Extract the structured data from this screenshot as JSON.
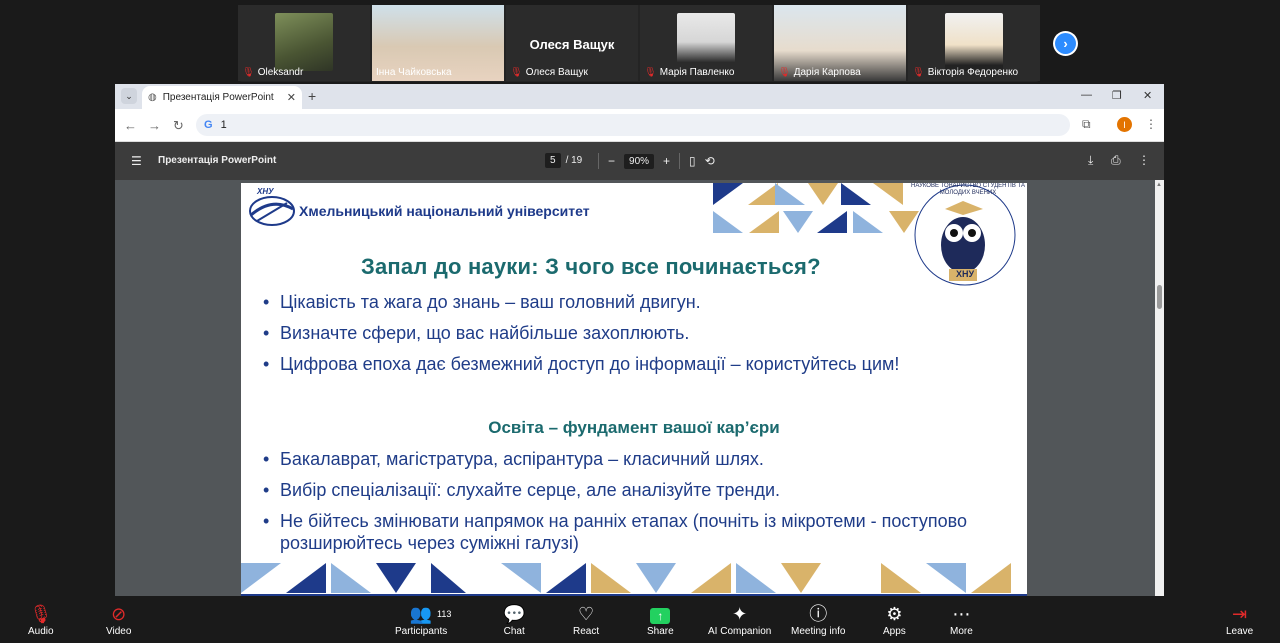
{
  "participants": [
    {
      "name": "Oleksandr",
      "muted": true
    },
    {
      "name": "Інна Чайковська",
      "muted": false,
      "active": true
    },
    {
      "name": "Олеся Ващук",
      "muted": true,
      "display_name": "Олеся Ващук"
    },
    {
      "name": "Марія Павленко",
      "muted": true
    },
    {
      "name": "Дарія Карпова",
      "muted": true
    },
    {
      "name": "Вікторія Федоренко",
      "muted": true
    }
  ],
  "browser": {
    "tab_title": "Презентація PowerPoint",
    "address": "1",
    "profile_initial": "I"
  },
  "pdf": {
    "title": "Презентація PowerPoint",
    "current_page": "5",
    "total_pages": "/ 19",
    "zoom": "90%"
  },
  "slide": {
    "university": "Хмельницький національний університет",
    "logo_text": "ХНУ",
    "heading": "Запал до науки: З чого все починається?",
    "bullets_top": [
      "Цікавість та жага до знань – ваш головний двигун.",
      "Визначте сфери, що вас найбільше захоплюють.",
      "Цифрова епоха дає безмежний доступ до інформації – користуйтесь цим!"
    ],
    "subheading": "Освіта – фундамент вашої кар’єри",
    "bullets_bottom": [
      "Бакалаврат, магістратура, аспірантура – класичний шлях.",
      "Вибір спеціалізації: слухайте серце, але аналізуйте тренди.",
      "Не бійтесь змінювати напрямок на ранніх етапах (почніть із мікротеми - поступово розширюйтесь через суміжні галузі)"
    ],
    "badge_text": "НАУКОВЕ ТОВАРИСТВО СТУДЕНТІВ ТА МОЛОДИХ ВЧЕНИХ",
    "badge_label": "ХНУ"
  },
  "toolbar": {
    "audio": "Audio",
    "video": "Video",
    "participants": "Participants",
    "participants_count": "113",
    "chat": "Chat",
    "react": "React",
    "share": "Share",
    "ai_companion": "AI Companion",
    "meeting_info": "Meeting info",
    "apps": "Apps",
    "more": "More",
    "leave": "Leave"
  },
  "colors": {
    "share_green": "#23d160",
    "mute_red": "#e02a2a",
    "slide_teal": "#1b6a6e",
    "slide_blue": "#1f3c88",
    "zoom_blue": "#2d8cff"
  }
}
